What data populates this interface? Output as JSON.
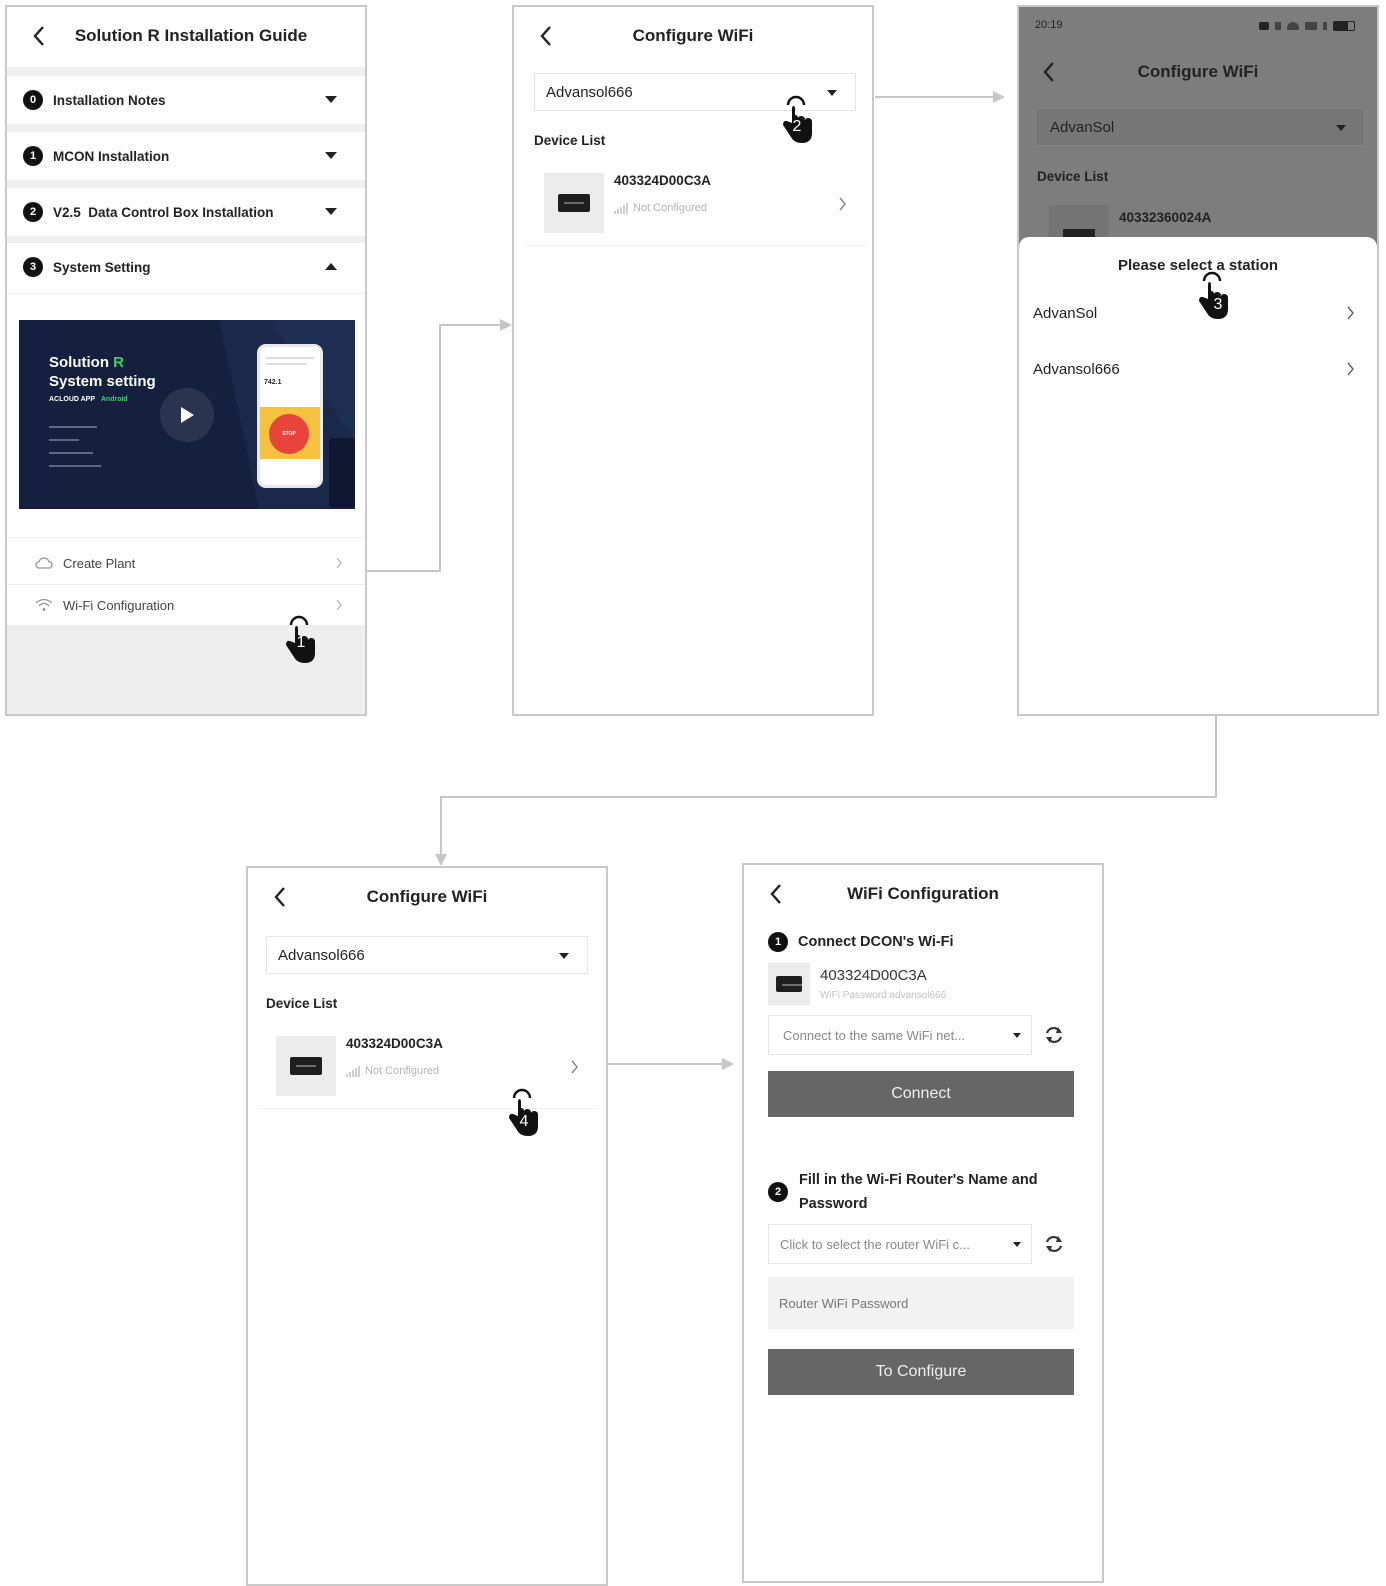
{
  "screen1": {
    "title": "Solution R Installation Guide",
    "accordion": [
      {
        "num": "0",
        "label": "Installation Notes"
      },
      {
        "num": "1",
        "label": "MCON Installation"
      },
      {
        "num": "2",
        "label": "V2.5  Data Control Box Installation"
      },
      {
        "num": "3",
        "label": "System Setting"
      }
    ],
    "video": {
      "title_line1": "Solution",
      "title_accent": "R",
      "title_line2": "System setting",
      "subtitle": "ACLOUD APP",
      "subtitle_accent": "Android",
      "phone_value": "742.1",
      "stop_label": "STOP"
    },
    "menu": [
      {
        "label": "Create Plant"
      },
      {
        "label": "Wi-Fi Configuration"
      }
    ],
    "tap_step": "1"
  },
  "screen2": {
    "title": "Configure WiFi",
    "station": "Advansol666",
    "device_list_label": "Device List",
    "device_id": "403324D00C3A",
    "device_status": "Not Configured",
    "tap_step": "2"
  },
  "screen3": {
    "status_time": "20:19",
    "title": "Configure WiFi",
    "station": "AdvanSol",
    "device_list_label": "Device List",
    "device_id": "40332360024A",
    "sheet_title": "Please select a station",
    "options": [
      {
        "label": "AdvanSol"
      },
      {
        "label": "Advansol666"
      }
    ],
    "tap_step": "3"
  },
  "screen4": {
    "title": "Configure WiFi",
    "station": "Advansol666",
    "device_list_label": "Device List",
    "device_id": "403324D00C3A",
    "device_status": "Not Configured",
    "tap_step": "4"
  },
  "screen5": {
    "title": "WiFi Configuration",
    "step1_num": "1",
    "step1_title": "Connect DCON's Wi-Fi",
    "device_id": "403324D00C3A",
    "wifi_password_text": "WiFi Password:advansol666",
    "wifi_select_placeholder": "Connect to the same WiFi net...",
    "connect_label": "Connect",
    "step2_num": "2",
    "step2_title_line1": "Fill in the Wi-Fi Router's Name and",
    "step2_title_line2": "Password",
    "router_select_placeholder": "Click to select the router WiFi c...",
    "router_password_placeholder": "Router WiFi Password",
    "configure_label": "To Configure"
  },
  "colors": {
    "accent_green": "#3ad06b",
    "stop_red": "#e8443c",
    "stop_yellow": "#f4c23e",
    "video_bg": "#14203e",
    "button_gray": "#666666",
    "overlay_gray": "#7d7d7d"
  }
}
